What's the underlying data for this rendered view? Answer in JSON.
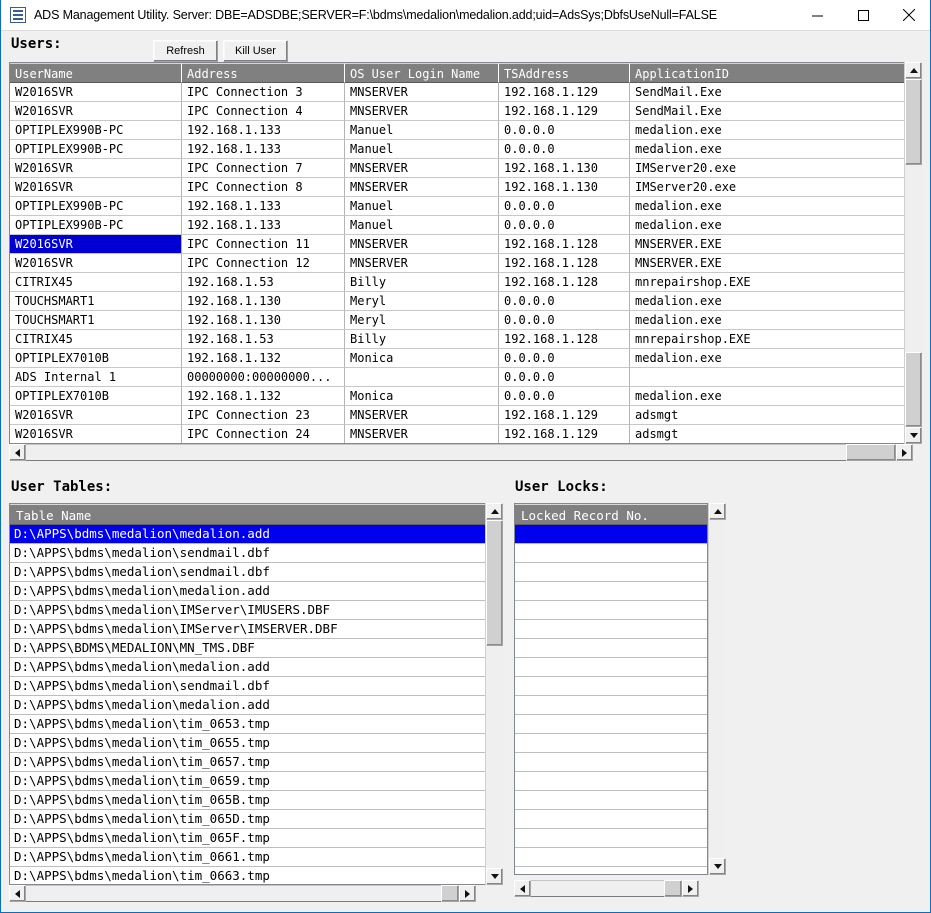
{
  "window": {
    "title": "ADS Management Utility. Server: DBE=ADSDBE;SERVER=F:\\bdms\\medalion\\medalion.add;uid=AdsSys;DbfsUseNull=FALSE",
    "icon": "grid-document-icon",
    "minimize_label": "–",
    "maximize_label": "☐",
    "close_label": "✕",
    "accent_color": "#0a6ebd",
    "background_color": "#f0f0f0"
  },
  "users_section": {
    "label": "Users:",
    "refresh_button": "Refresh",
    "kill_user_button": "Kill User",
    "columns": [
      "UserName",
      "Address",
      "OS User Login Name",
      "TSAddress",
      "ApplicationID"
    ],
    "selected_row_index": 8,
    "rows": [
      [
        "W2016SVR",
        "IPC Connection 3",
        "MNSERVER",
        "192.168.1.129",
        "SendMail.Exe"
      ],
      [
        "W2016SVR",
        "IPC Connection 4",
        "MNSERVER",
        "192.168.1.129",
        "SendMail.Exe"
      ],
      [
        "OPTIPLEX990B-PC",
        "192.168.1.133",
        "Manuel",
        "0.0.0.0",
        "medalion.exe"
      ],
      [
        "OPTIPLEX990B-PC",
        "192.168.1.133",
        "Manuel",
        "0.0.0.0",
        "medalion.exe"
      ],
      [
        "W2016SVR",
        "IPC Connection 7",
        "MNSERVER",
        "192.168.1.130",
        "IMServer20.exe"
      ],
      [
        "W2016SVR",
        "IPC Connection 8",
        "MNSERVER",
        "192.168.1.130",
        "IMServer20.exe"
      ],
      [
        "OPTIPLEX990B-PC",
        "192.168.1.133",
        "Manuel",
        "0.0.0.0",
        "medalion.exe"
      ],
      [
        "OPTIPLEX990B-PC",
        "192.168.1.133",
        "Manuel",
        "0.0.0.0",
        "medalion.exe"
      ],
      [
        "W2016SVR",
        "IPC Connection 11",
        "MNSERVER",
        "192.168.1.128",
        "MNSERVER.EXE"
      ],
      [
        "W2016SVR",
        "IPC Connection 12",
        "MNSERVER",
        "192.168.1.128",
        "MNSERVER.EXE"
      ],
      [
        "CITRIX45",
        "192.168.1.53",
        "Billy",
        "192.168.1.128",
        "mnrepairshop.EXE"
      ],
      [
        "TOUCHSMART1",
        "192.168.1.130",
        "Meryl",
        "0.0.0.0",
        "medalion.exe"
      ],
      [
        "TOUCHSMART1",
        "192.168.1.130",
        "Meryl",
        "0.0.0.0",
        "medalion.exe"
      ],
      [
        "CITRIX45",
        "192.168.1.53",
        "Billy",
        "192.168.1.128",
        "mnrepairshop.EXE"
      ],
      [
        "OPTIPLEX7010B",
        "192.168.1.132",
        "Monica",
        "0.0.0.0",
        "medalion.exe"
      ],
      [
        "ADS Internal 1",
        "00000000:00000000...",
        "",
        "0.0.0.0",
        ""
      ],
      [
        "OPTIPLEX7010B",
        "192.168.1.132",
        "Monica",
        "0.0.0.0",
        "medalion.exe"
      ],
      [
        "W2016SVR",
        "IPC Connection 23",
        "MNSERVER",
        "192.168.1.129",
        "adsmgt"
      ],
      [
        "W2016SVR",
        "IPC Connection 24",
        "MNSERVER",
        "192.168.1.129",
        "adsmgt"
      ]
    ]
  },
  "user_tables_section": {
    "label": "User Tables:",
    "header": "Table Name",
    "selected_row_index": 0,
    "rows": [
      "D:\\APPS\\bdms\\medalion\\medalion.add",
      "D:\\APPS\\bdms\\medalion\\sendmail.dbf",
      "D:\\APPS\\bdms\\medalion\\sendmail.dbf",
      "D:\\APPS\\bdms\\medalion\\medalion.add",
      "D:\\APPS\\bdms\\medalion\\IMServer\\IMUSERS.DBF",
      "D:\\APPS\\bdms\\medalion\\IMServer\\IMSERVER.DBF",
      "D:\\APPS\\BDMS\\MEDALION\\MN_TMS.DBF",
      "D:\\APPS\\bdms\\medalion\\medalion.add",
      "D:\\APPS\\bdms\\medalion\\sendmail.dbf",
      "D:\\APPS\\bdms\\medalion\\medalion.add",
      "D:\\APPS\\bdms\\medalion\\tim_0653.tmp",
      "D:\\APPS\\bdms\\medalion\\tim_0655.tmp",
      "D:\\APPS\\bdms\\medalion\\tim_0657.tmp",
      "D:\\APPS\\bdms\\medalion\\tim_0659.tmp",
      "D:\\APPS\\bdms\\medalion\\tim_065B.tmp",
      "D:\\APPS\\bdms\\medalion\\tim_065D.tmp",
      "D:\\APPS\\bdms\\medalion\\tim_065F.tmp",
      "D:\\APPS\\bdms\\medalion\\tim_0661.tmp",
      "D:\\APPS\\bdms\\medalion\\tim_0663.tmp"
    ]
  },
  "user_locks_section": {
    "label": "User Locks:",
    "header": "Locked Record No.",
    "selected_row_index": 0,
    "rows": [
      "",
      "",
      "",
      "",
      "",
      "",
      "",
      "",
      "",
      "",
      "",
      "",
      "",
      "",
      "",
      "",
      "",
      "",
      ""
    ]
  },
  "icons": {
    "scroll_up": "triangle-up-icon",
    "scroll_down": "triangle-down-icon",
    "scroll_left": "triangle-left-icon",
    "scroll_right": "triangle-right-icon"
  }
}
